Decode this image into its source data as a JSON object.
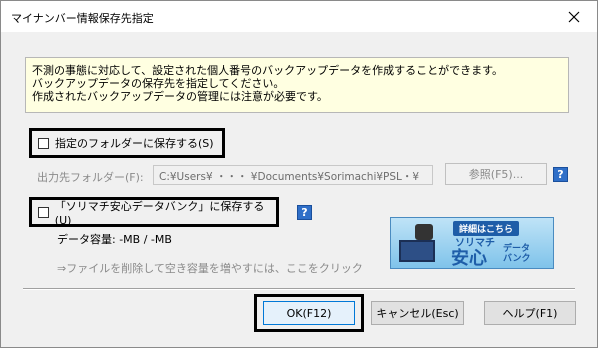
{
  "window": {
    "title": "マイナンバー情報保存先指定",
    "close_icon": "close-icon"
  },
  "info": {
    "line1": "不測の事態に対応して、設定された個人番号のバックアップデータを作成することができます。",
    "line2": "バックアップデータの保存先を指定してください。",
    "line3": "作成されたバックアップデータの管理には注意が必要です。"
  },
  "option_folder": {
    "label": "指定のフォルダーに保存する(S)",
    "checked": false
  },
  "output_folder": {
    "label": "出力先フォルダー(F):",
    "value": "C:¥Users¥ ・・・ ¥Documents¥Sorimachi¥PSL・¥",
    "browse_label": "参照(F5)..."
  },
  "option_bank": {
    "label": "「ソリマチ安心データバンク」に保存する(U)",
    "checked": false
  },
  "capacity": {
    "text": "データ容量:  -MB / -MB"
  },
  "hint": {
    "text": "⇒ファイルを削除して空き容量を増やすには、ここをクリック"
  },
  "banner": {
    "badge": "詳細はこちら",
    "brand": "ソリマチ",
    "big": "安心",
    "small1": "データ",
    "small2": "バンク"
  },
  "help_icon_text": "?",
  "buttons": {
    "ok": "OK(F12)",
    "cancel": "キャンセル(Esc)",
    "help": "ヘルプ(F1)"
  }
}
